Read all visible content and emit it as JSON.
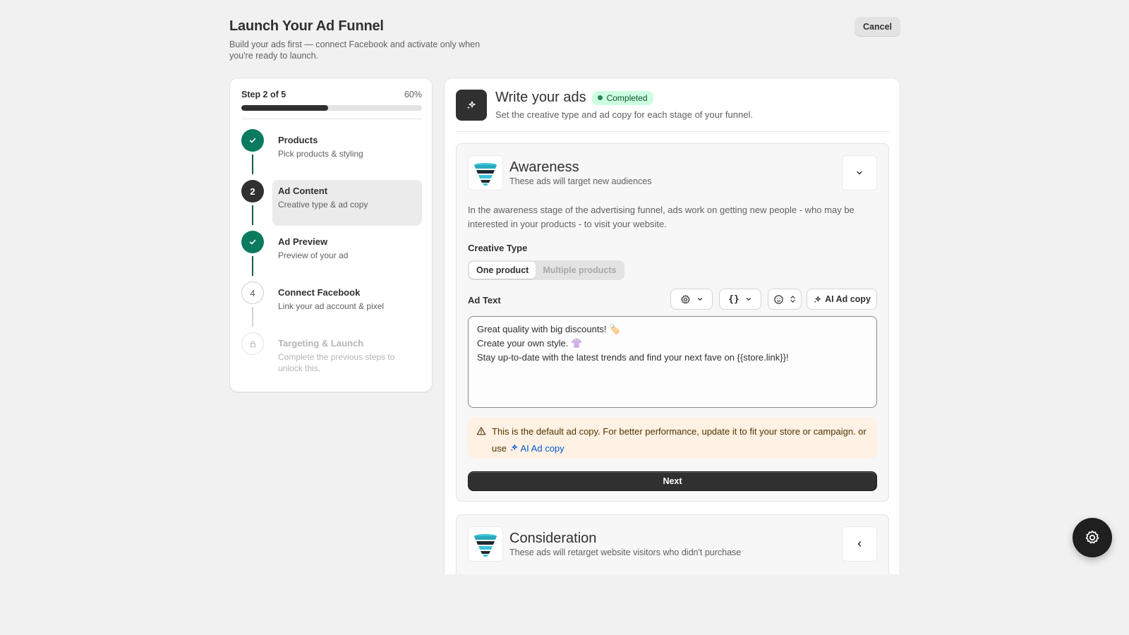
{
  "header": {
    "title": "Launch Your Ad Funnel",
    "subtitle": "Build your ads first — connect Facebook and activate only when you're ready to launch.",
    "cancel_label": "Cancel"
  },
  "stepper": {
    "step_label": "Step 2 of 5",
    "percent_label": "60%",
    "progress": 0.48,
    "steps": [
      {
        "marker": "",
        "title": "Products",
        "subtitle": "Pick products & styling",
        "status": "done"
      },
      {
        "marker": "2",
        "title": "Ad Content",
        "subtitle": "Creative type & ad copy",
        "status": "active"
      },
      {
        "marker": "",
        "title": "Ad Preview",
        "subtitle": "Preview of your ad",
        "status": "done"
      },
      {
        "marker": "4",
        "title": "Connect Facebook",
        "subtitle": "Link your ad account & pixel",
        "status": "todo"
      },
      {
        "marker": "",
        "title": "Targeting & Launch",
        "subtitle": "Complete the previous steps to unlock this.",
        "status": "locked"
      }
    ]
  },
  "main": {
    "title": "Write your ads",
    "badge": "Completed",
    "subtitle": "Set the creative type and ad copy for each stage of your funnel.",
    "awareness": {
      "title": "Awareness",
      "subtitle": "These ads will target new audiences",
      "description": "In the awareness stage of the advertising funnel, ads work on getting new people - who may be interested in your products - to visit your website.",
      "creative_type_label": "Creative Type",
      "creative_options": [
        "One product",
        "Multiple products"
      ],
      "ad_text_label": "Ad Text",
      "ai_button_label": "AI Ad copy",
      "ad_text_lines": [
        "Great quality with big discounts! 🏷️",
        "Create your own style. 👚",
        "Stay up-to-date with the latest trends and find your next fave on {{store.link}}!"
      ],
      "warning_text": "This is the default ad copy. For better performance, update it to fit your store or campaign. or use",
      "warning_link": "AI Ad copy",
      "next_label": "Next"
    },
    "consideration": {
      "title": "Consideration",
      "subtitle": "These ads will retarget website visitors who didn't purchase"
    }
  },
  "icons": {
    "check": "check-icon",
    "lock": "lock-icon",
    "sparkle": "sparkle-icon",
    "funnel": "funnel-icon",
    "settings": "gear-icon",
    "variables": "braces-icon",
    "emoji": "emoji-icon",
    "warning": "warning-icon"
  },
  "colors": {
    "done": "#0b7a5e",
    "active": "#303030",
    "badge_bg": "#cdfee1",
    "warning_bg": "#fff1e3",
    "link": "#005bd3"
  }
}
